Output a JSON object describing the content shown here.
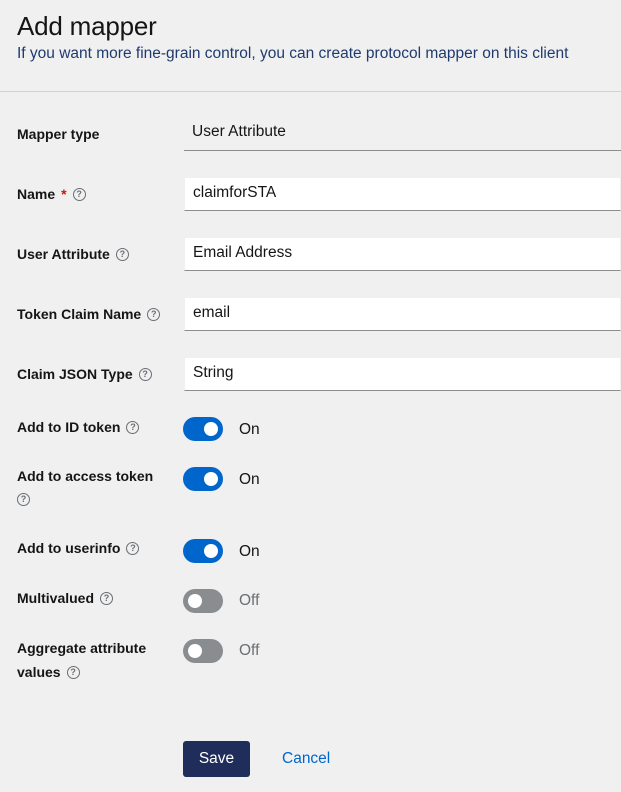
{
  "header": {
    "title": "Add mapper",
    "subtitle": "If you want more fine-grain control, you can create protocol mapper on this client"
  },
  "form": {
    "mapper_type": {
      "label": "Mapper type",
      "value": "User Attribute"
    },
    "name": {
      "label": "Name",
      "required_mark": "*",
      "value": "claimforSTA"
    },
    "user_attribute": {
      "label": "User Attribute",
      "value": "Email Address"
    },
    "token_claim_name": {
      "label": "Token Claim Name",
      "value": "email"
    },
    "claim_json_type": {
      "label": "Claim JSON Type",
      "value": "String"
    },
    "add_to_id_token": {
      "label": "Add to ID token",
      "state": "On"
    },
    "add_to_access_token": {
      "label": "Add to access token",
      "state": "On"
    },
    "add_to_userinfo": {
      "label": "Add to userinfo",
      "state": "On"
    },
    "multivalued": {
      "label": "Multivalued",
      "state": "Off"
    },
    "aggregate_attribute_values": {
      "label_line1": "Aggregate attribute",
      "label_line2": "values",
      "state": "Off"
    }
  },
  "help_glyph": "?",
  "actions": {
    "save_label": "Save",
    "cancel_label": "Cancel"
  },
  "colors": {
    "accent": "#0066cc",
    "primary_button": "#1f2d5a",
    "toggle_off": "#8a8d90",
    "required": "#c9190b"
  }
}
